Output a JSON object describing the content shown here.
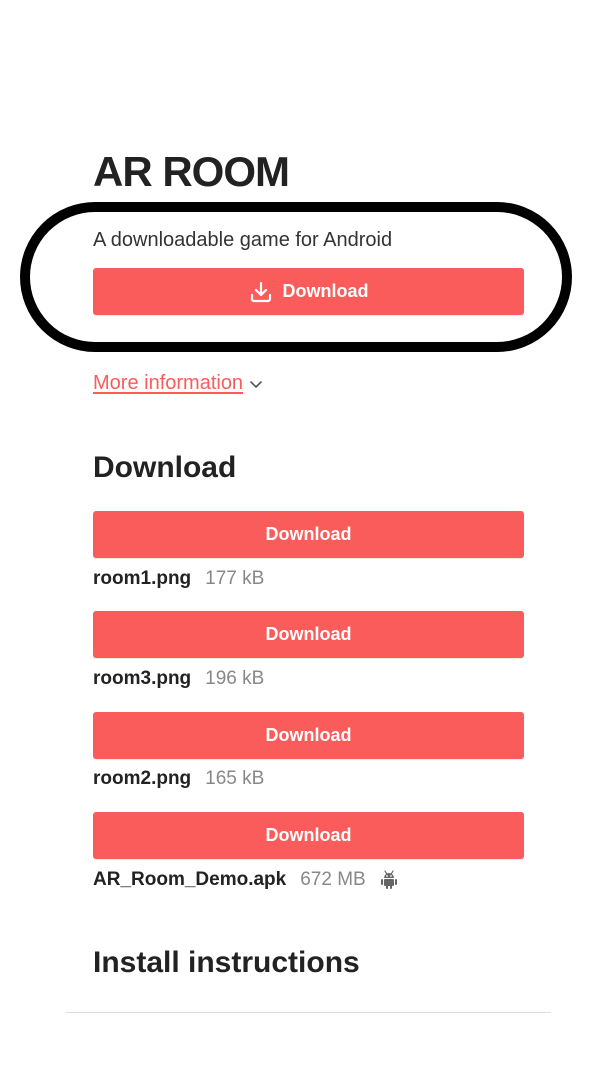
{
  "game": {
    "title": "AR ROOM",
    "tagline": "A downloadable game for Android",
    "primary_button_label": "Download"
  },
  "more_info": {
    "label": "More information"
  },
  "download_section": {
    "heading": "Download",
    "files": [
      {
        "button_label": "Download",
        "name": "room1.png",
        "size": "177 kB",
        "platform_icon": ""
      },
      {
        "button_label": "Download",
        "name": "room3.png",
        "size": "196 kB",
        "platform_icon": ""
      },
      {
        "button_label": "Download",
        "name": "room2.png",
        "size": "165 kB",
        "platform_icon": ""
      },
      {
        "button_label": "Download",
        "name": "AR_Room_Demo.apk",
        "size": "672 MB",
        "platform_icon": "android-icon"
      }
    ]
  },
  "install_section": {
    "heading": "Install instructions"
  },
  "icons": {
    "primary_button": "download-icon",
    "more_info": "chevron-down-icon"
  },
  "colors": {
    "accent": "#fa5c5c",
    "annotation_ring": "#000000",
    "text": "#222222",
    "muted": "#888888"
  }
}
